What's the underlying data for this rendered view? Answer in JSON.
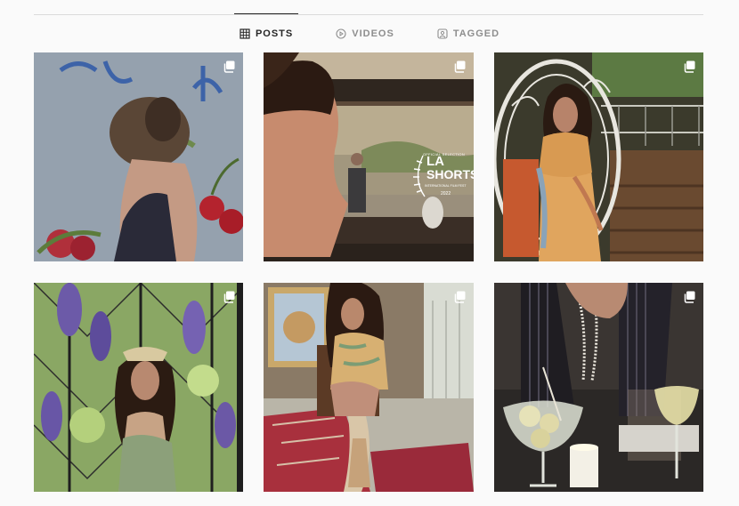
{
  "tabs": [
    {
      "label": "POSTS",
      "icon": "grid-icon",
      "active": true
    },
    {
      "label": "VIDEOS",
      "icon": "play-icon",
      "active": false
    },
    {
      "label": "TAGGED",
      "icon": "tag-user-icon",
      "active": false
    }
  ],
  "posts": [
    {
      "id": "post-1",
      "icon": "multi-photo-icon"
    },
    {
      "id": "post-2",
      "icon": "multi-photo-icon",
      "overlay": {
        "badge_top": "OFFICIAL SELECTION",
        "badge_main_1": "LA",
        "badge_main_2": "SHORTS",
        "badge_sub": "INTERNATIONAL FILM FEST",
        "badge_year": "2022"
      }
    },
    {
      "id": "post-3",
      "icon": "multi-photo-icon"
    },
    {
      "id": "post-4",
      "icon": "multi-photo-icon"
    },
    {
      "id": "post-5",
      "icon": "multi-photo-icon"
    },
    {
      "id": "post-6",
      "icon": "multi-photo-icon"
    }
  ],
  "colors": {
    "active_tab": "#262626",
    "inactive_tab": "#8e8e8e",
    "divider": "#dbdbdb",
    "background": "#fafafa"
  }
}
